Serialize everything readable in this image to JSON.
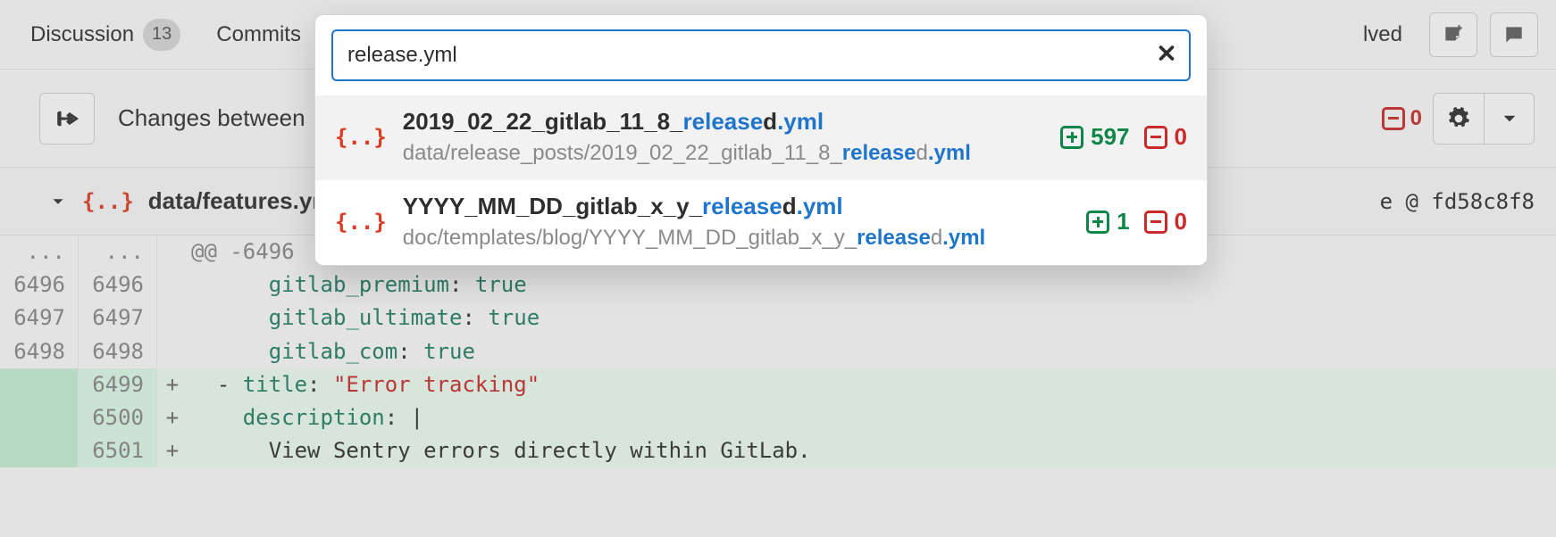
{
  "tabs": {
    "discussion_label": "Discussion",
    "discussion_count": "13",
    "commits_label": "Commits",
    "resolved_label": "lved"
  },
  "subbar": {
    "changes_between_label": "Changes between",
    "deletions_tail": "0"
  },
  "file_header": {
    "path": "data/features.ym",
    "view_at": "e @ fd58c8f8"
  },
  "diff": {
    "hunk": "@@ -6496",
    "rows": [
      {
        "old": "6496",
        "new": "6496",
        "sign": " ",
        "key": "gitlab_premium",
        "val": "true",
        "type": "ctx"
      },
      {
        "old": "6497",
        "new": "6497",
        "sign": " ",
        "key": "gitlab_ultimate",
        "val": "true",
        "type": "ctx"
      },
      {
        "old": "6498",
        "new": "6498",
        "sign": " ",
        "key": "gitlab_com",
        "val": "true",
        "type": "ctx"
      },
      {
        "old": "",
        "new": "6499",
        "sign": "+",
        "raw": "  - title: \"Error tracking\"",
        "type": "add"
      },
      {
        "old": "",
        "new": "6500",
        "sign": "+",
        "raw": "    description: |",
        "type": "add"
      },
      {
        "old": "",
        "new": "6501",
        "sign": "+",
        "raw": "      View Sentry errors directly within GitLab.",
        "type": "add"
      }
    ]
  },
  "search": {
    "query": "release.yml",
    "results": [
      {
        "name_pre": "2019_02_22_gitlab_11_8_",
        "name_hl": "release",
        "name_post_d": "d",
        "name_ext": ".yml",
        "path_pre": "data/release_posts/2019_02_22_gitlab_11_8_",
        "path_hl": "release",
        "path_post_d": "d",
        "path_ext": ".yml",
        "additions": "597",
        "deletions": "0",
        "selected": true
      },
      {
        "name_pre": "YYYY_MM_DD_gitlab_x_y_",
        "name_hl": "release",
        "name_post_d": "d",
        "name_ext": ".yml",
        "path_pre": "doc/templates/blog/YYYY_MM_DD_gitlab_x_y_",
        "path_hl": "release",
        "path_post_d": "d",
        "path_ext": ".yml",
        "additions": "1",
        "deletions": "0",
        "selected": false
      }
    ]
  }
}
